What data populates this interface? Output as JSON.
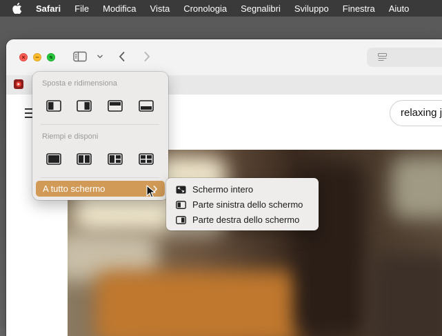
{
  "menubar": {
    "items": [
      {
        "label": "Safari",
        "bold": true
      },
      {
        "label": "File",
        "bold": false
      },
      {
        "label": "Modifica",
        "bold": false
      },
      {
        "label": "Vista",
        "bold": false
      },
      {
        "label": "Cronologia",
        "bold": false
      },
      {
        "label": "Segnalibri",
        "bold": false
      },
      {
        "label": "Sviluppo",
        "bold": false
      },
      {
        "label": "Finestra",
        "bold": false
      },
      {
        "label": "Aiuto",
        "bold": false
      }
    ]
  },
  "toolbar": {
    "icons": [
      "sidebar-icon",
      "chevron-down-icon",
      "back-icon",
      "forward-icon"
    ]
  },
  "page": {
    "search_value": "relaxing j"
  },
  "popover": {
    "move_resize_label": "Sposta e ridimensiona",
    "fill_arrange_label": "Riempi e disponi",
    "fullscreen_label": "A tutto schermo",
    "accent_color": "#d19a57"
  },
  "submenu": {
    "items": [
      {
        "label": "Schermo intero",
        "icon": "enter-fullscreen-icon"
      },
      {
        "label": "Parte sinistra dello schermo",
        "icon": "left-half-icon"
      },
      {
        "label": "Parte destra dello schermo",
        "icon": "right-half-icon"
      }
    ]
  }
}
